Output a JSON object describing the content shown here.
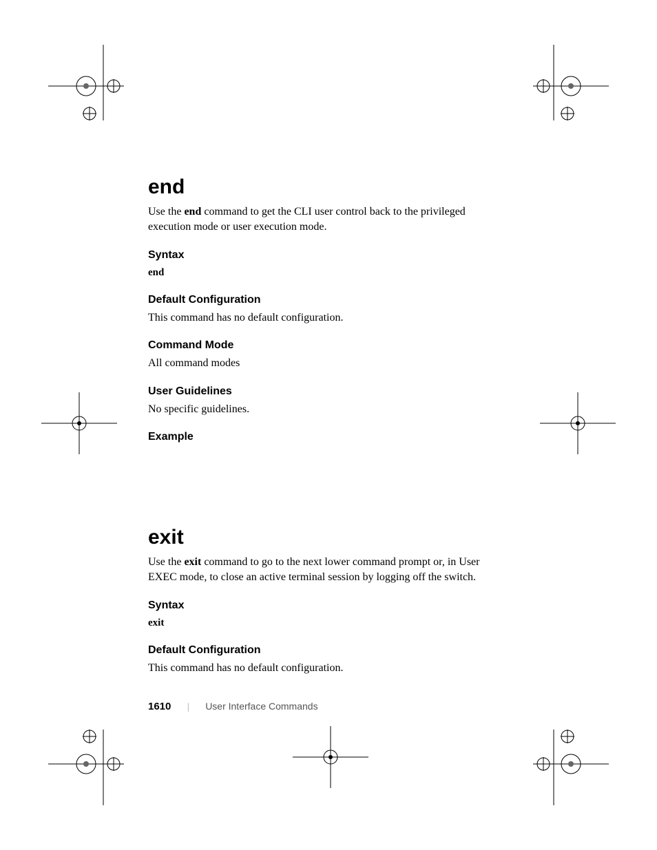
{
  "section1": {
    "title": "end",
    "intro_pre": "Use the ",
    "intro_bold": "end",
    "intro_post": " command to get the CLI user control back to the privileged execution mode or user execution mode.",
    "syntax_h": "Syntax",
    "syntax_cmd": "end",
    "defcfg_h": "Default Configuration",
    "defcfg_body": "This command has no default configuration.",
    "mode_h": "Command Mode",
    "mode_body": "All command modes",
    "guide_h": "User Guidelines",
    "guide_body": "No specific guidelines.",
    "example_h": "Example"
  },
  "section2": {
    "title": "exit",
    "intro_pre": "Use the ",
    "intro_bold": "exit",
    "intro_post": " command to go to the next lower command prompt or, in User EXEC mode, to close an active terminal session by logging off the switch.",
    "syntax_h": "Syntax",
    "syntax_cmd": "exit",
    "defcfg_h": "Default Configuration",
    "defcfg_body": "This command has no default configuration."
  },
  "footer": {
    "page": "1610",
    "divider": "|",
    "title": "User Interface Commands"
  }
}
